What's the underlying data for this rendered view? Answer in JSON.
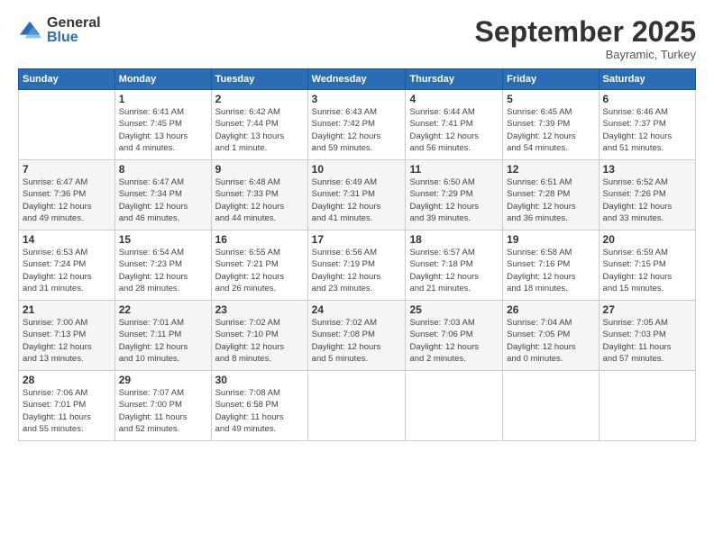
{
  "logo": {
    "general": "General",
    "blue": "Blue"
  },
  "header": {
    "month": "September 2025",
    "location": "Bayramic, Turkey"
  },
  "weekdays": [
    "Sunday",
    "Monday",
    "Tuesday",
    "Wednesday",
    "Thursday",
    "Friday",
    "Saturday"
  ],
  "weeks": [
    [
      {
        "day": "",
        "info": ""
      },
      {
        "day": "1",
        "info": "Sunrise: 6:41 AM\nSunset: 7:45 PM\nDaylight: 13 hours\nand 4 minutes."
      },
      {
        "day": "2",
        "info": "Sunrise: 6:42 AM\nSunset: 7:44 PM\nDaylight: 13 hours\nand 1 minute."
      },
      {
        "day": "3",
        "info": "Sunrise: 6:43 AM\nSunset: 7:42 PM\nDaylight: 12 hours\nand 59 minutes."
      },
      {
        "day": "4",
        "info": "Sunrise: 6:44 AM\nSunset: 7:41 PM\nDaylight: 12 hours\nand 56 minutes."
      },
      {
        "day": "5",
        "info": "Sunrise: 6:45 AM\nSunset: 7:39 PM\nDaylight: 12 hours\nand 54 minutes."
      },
      {
        "day": "6",
        "info": "Sunrise: 6:46 AM\nSunset: 7:37 PM\nDaylight: 12 hours\nand 51 minutes."
      }
    ],
    [
      {
        "day": "7",
        "info": "Sunrise: 6:47 AM\nSunset: 7:36 PM\nDaylight: 12 hours\nand 49 minutes."
      },
      {
        "day": "8",
        "info": "Sunrise: 6:47 AM\nSunset: 7:34 PM\nDaylight: 12 hours\nand 46 minutes."
      },
      {
        "day": "9",
        "info": "Sunrise: 6:48 AM\nSunset: 7:33 PM\nDaylight: 12 hours\nand 44 minutes."
      },
      {
        "day": "10",
        "info": "Sunrise: 6:49 AM\nSunset: 7:31 PM\nDaylight: 12 hours\nand 41 minutes."
      },
      {
        "day": "11",
        "info": "Sunrise: 6:50 AM\nSunset: 7:29 PM\nDaylight: 12 hours\nand 39 minutes."
      },
      {
        "day": "12",
        "info": "Sunrise: 6:51 AM\nSunset: 7:28 PM\nDaylight: 12 hours\nand 36 minutes."
      },
      {
        "day": "13",
        "info": "Sunrise: 6:52 AM\nSunset: 7:26 PM\nDaylight: 12 hours\nand 33 minutes."
      }
    ],
    [
      {
        "day": "14",
        "info": "Sunrise: 6:53 AM\nSunset: 7:24 PM\nDaylight: 12 hours\nand 31 minutes."
      },
      {
        "day": "15",
        "info": "Sunrise: 6:54 AM\nSunset: 7:23 PM\nDaylight: 12 hours\nand 28 minutes."
      },
      {
        "day": "16",
        "info": "Sunrise: 6:55 AM\nSunset: 7:21 PM\nDaylight: 12 hours\nand 26 minutes."
      },
      {
        "day": "17",
        "info": "Sunrise: 6:56 AM\nSunset: 7:19 PM\nDaylight: 12 hours\nand 23 minutes."
      },
      {
        "day": "18",
        "info": "Sunrise: 6:57 AM\nSunset: 7:18 PM\nDaylight: 12 hours\nand 21 minutes."
      },
      {
        "day": "19",
        "info": "Sunrise: 6:58 AM\nSunset: 7:16 PM\nDaylight: 12 hours\nand 18 minutes."
      },
      {
        "day": "20",
        "info": "Sunrise: 6:59 AM\nSunset: 7:15 PM\nDaylight: 12 hours\nand 15 minutes."
      }
    ],
    [
      {
        "day": "21",
        "info": "Sunrise: 7:00 AM\nSunset: 7:13 PM\nDaylight: 12 hours\nand 13 minutes."
      },
      {
        "day": "22",
        "info": "Sunrise: 7:01 AM\nSunset: 7:11 PM\nDaylight: 12 hours\nand 10 minutes."
      },
      {
        "day": "23",
        "info": "Sunrise: 7:02 AM\nSunset: 7:10 PM\nDaylight: 12 hours\nand 8 minutes."
      },
      {
        "day": "24",
        "info": "Sunrise: 7:02 AM\nSunset: 7:08 PM\nDaylight: 12 hours\nand 5 minutes."
      },
      {
        "day": "25",
        "info": "Sunrise: 7:03 AM\nSunset: 7:06 PM\nDaylight: 12 hours\nand 2 minutes."
      },
      {
        "day": "26",
        "info": "Sunrise: 7:04 AM\nSunset: 7:05 PM\nDaylight: 12 hours\nand 0 minutes."
      },
      {
        "day": "27",
        "info": "Sunrise: 7:05 AM\nSunset: 7:03 PM\nDaylight: 11 hours\nand 57 minutes."
      }
    ],
    [
      {
        "day": "28",
        "info": "Sunrise: 7:06 AM\nSunset: 7:01 PM\nDaylight: 11 hours\nand 55 minutes."
      },
      {
        "day": "29",
        "info": "Sunrise: 7:07 AM\nSunset: 7:00 PM\nDaylight: 11 hours\nand 52 minutes."
      },
      {
        "day": "30",
        "info": "Sunrise: 7:08 AM\nSunset: 6:58 PM\nDaylight: 11 hours\nand 49 minutes."
      },
      {
        "day": "",
        "info": ""
      },
      {
        "day": "",
        "info": ""
      },
      {
        "day": "",
        "info": ""
      },
      {
        "day": "",
        "info": ""
      }
    ]
  ]
}
